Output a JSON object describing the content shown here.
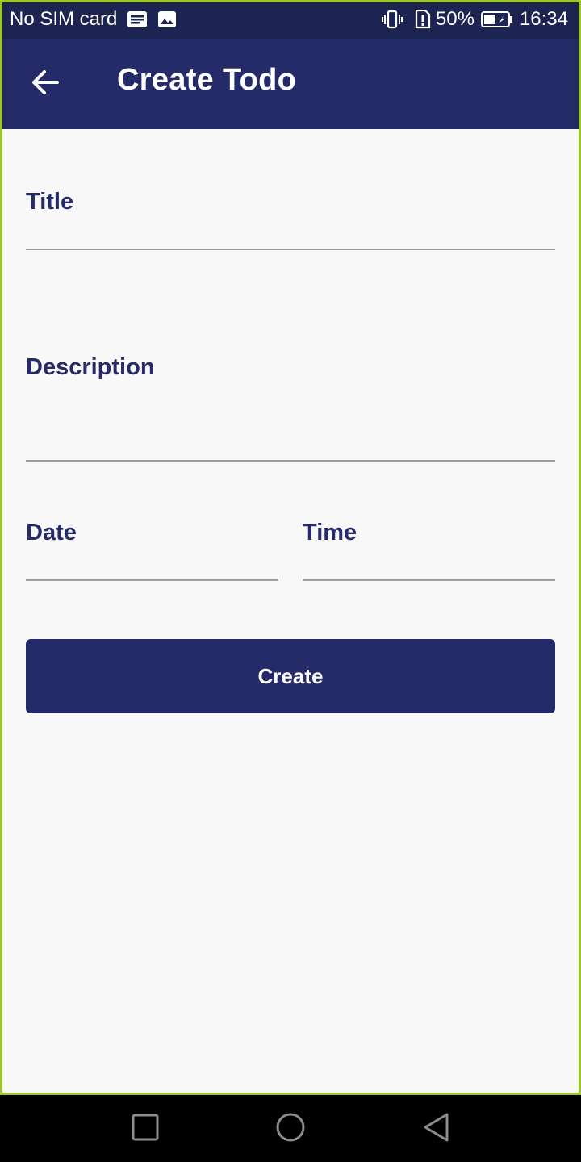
{
  "status_bar": {
    "carrier": "No SIM card",
    "battery_percent": "50%",
    "time": "16:34",
    "icons": [
      "message-icon",
      "image-icon",
      "vibrate-icon",
      "alert-icon",
      "battery-icon"
    ]
  },
  "app_bar": {
    "title": "Create Todo",
    "back_icon": "back-arrow-icon"
  },
  "form": {
    "title_label": "Title",
    "title_value": "",
    "description_label": "Description",
    "description_value": "",
    "date_label": "Date",
    "date_value": "",
    "time_label": "Time",
    "time_value": "",
    "create_label": "Create"
  },
  "nav_bar": {
    "icons": [
      "recents-icon",
      "home-icon",
      "back-triangle-icon"
    ]
  },
  "colors": {
    "primary": "#252b69",
    "status_bar": "#1e2452",
    "background": "#f8f8f8",
    "frame_border": "#9fc52c",
    "underline": "#9e9e9e"
  }
}
